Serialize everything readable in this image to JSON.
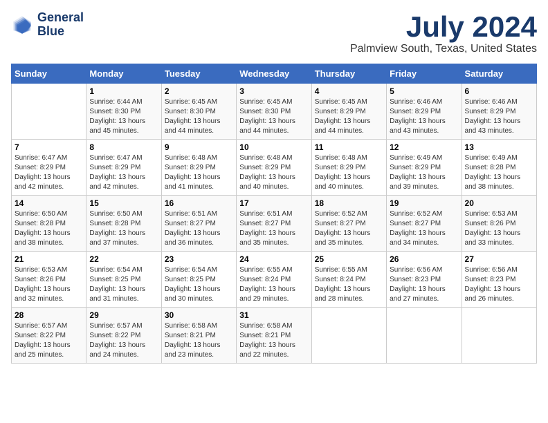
{
  "logo": {
    "line1": "General",
    "line2": "Blue"
  },
  "title": "July 2024",
  "subtitle": "Palmview South, Texas, United States",
  "days_of_week": [
    "Sunday",
    "Monday",
    "Tuesday",
    "Wednesday",
    "Thursday",
    "Friday",
    "Saturday"
  ],
  "weeks": [
    [
      {
        "num": "",
        "info": ""
      },
      {
        "num": "1",
        "info": "Sunrise: 6:44 AM\nSunset: 8:30 PM\nDaylight: 13 hours\nand 45 minutes."
      },
      {
        "num": "2",
        "info": "Sunrise: 6:45 AM\nSunset: 8:30 PM\nDaylight: 13 hours\nand 44 minutes."
      },
      {
        "num": "3",
        "info": "Sunrise: 6:45 AM\nSunset: 8:30 PM\nDaylight: 13 hours\nand 44 minutes."
      },
      {
        "num": "4",
        "info": "Sunrise: 6:45 AM\nSunset: 8:29 PM\nDaylight: 13 hours\nand 44 minutes."
      },
      {
        "num": "5",
        "info": "Sunrise: 6:46 AM\nSunset: 8:29 PM\nDaylight: 13 hours\nand 43 minutes."
      },
      {
        "num": "6",
        "info": "Sunrise: 6:46 AM\nSunset: 8:29 PM\nDaylight: 13 hours\nand 43 minutes."
      }
    ],
    [
      {
        "num": "7",
        "info": "Sunrise: 6:47 AM\nSunset: 8:29 PM\nDaylight: 13 hours\nand 42 minutes."
      },
      {
        "num": "8",
        "info": "Sunrise: 6:47 AM\nSunset: 8:29 PM\nDaylight: 13 hours\nand 42 minutes."
      },
      {
        "num": "9",
        "info": "Sunrise: 6:48 AM\nSunset: 8:29 PM\nDaylight: 13 hours\nand 41 minutes."
      },
      {
        "num": "10",
        "info": "Sunrise: 6:48 AM\nSunset: 8:29 PM\nDaylight: 13 hours\nand 40 minutes."
      },
      {
        "num": "11",
        "info": "Sunrise: 6:48 AM\nSunset: 8:29 PM\nDaylight: 13 hours\nand 40 minutes."
      },
      {
        "num": "12",
        "info": "Sunrise: 6:49 AM\nSunset: 8:29 PM\nDaylight: 13 hours\nand 39 minutes."
      },
      {
        "num": "13",
        "info": "Sunrise: 6:49 AM\nSunset: 8:28 PM\nDaylight: 13 hours\nand 38 minutes."
      }
    ],
    [
      {
        "num": "14",
        "info": "Sunrise: 6:50 AM\nSunset: 8:28 PM\nDaylight: 13 hours\nand 38 minutes."
      },
      {
        "num": "15",
        "info": "Sunrise: 6:50 AM\nSunset: 8:28 PM\nDaylight: 13 hours\nand 37 minutes."
      },
      {
        "num": "16",
        "info": "Sunrise: 6:51 AM\nSunset: 8:27 PM\nDaylight: 13 hours\nand 36 minutes."
      },
      {
        "num": "17",
        "info": "Sunrise: 6:51 AM\nSunset: 8:27 PM\nDaylight: 13 hours\nand 35 minutes."
      },
      {
        "num": "18",
        "info": "Sunrise: 6:52 AM\nSunset: 8:27 PM\nDaylight: 13 hours\nand 35 minutes."
      },
      {
        "num": "19",
        "info": "Sunrise: 6:52 AM\nSunset: 8:27 PM\nDaylight: 13 hours\nand 34 minutes."
      },
      {
        "num": "20",
        "info": "Sunrise: 6:53 AM\nSunset: 8:26 PM\nDaylight: 13 hours\nand 33 minutes."
      }
    ],
    [
      {
        "num": "21",
        "info": "Sunrise: 6:53 AM\nSunset: 8:26 PM\nDaylight: 13 hours\nand 32 minutes."
      },
      {
        "num": "22",
        "info": "Sunrise: 6:54 AM\nSunset: 8:25 PM\nDaylight: 13 hours\nand 31 minutes."
      },
      {
        "num": "23",
        "info": "Sunrise: 6:54 AM\nSunset: 8:25 PM\nDaylight: 13 hours\nand 30 minutes."
      },
      {
        "num": "24",
        "info": "Sunrise: 6:55 AM\nSunset: 8:24 PM\nDaylight: 13 hours\nand 29 minutes."
      },
      {
        "num": "25",
        "info": "Sunrise: 6:55 AM\nSunset: 8:24 PM\nDaylight: 13 hours\nand 28 minutes."
      },
      {
        "num": "26",
        "info": "Sunrise: 6:56 AM\nSunset: 8:23 PM\nDaylight: 13 hours\nand 27 minutes."
      },
      {
        "num": "27",
        "info": "Sunrise: 6:56 AM\nSunset: 8:23 PM\nDaylight: 13 hours\nand 26 minutes."
      }
    ],
    [
      {
        "num": "28",
        "info": "Sunrise: 6:57 AM\nSunset: 8:22 PM\nDaylight: 13 hours\nand 25 minutes."
      },
      {
        "num": "29",
        "info": "Sunrise: 6:57 AM\nSunset: 8:22 PM\nDaylight: 13 hours\nand 24 minutes."
      },
      {
        "num": "30",
        "info": "Sunrise: 6:58 AM\nSunset: 8:21 PM\nDaylight: 13 hours\nand 23 minutes."
      },
      {
        "num": "31",
        "info": "Sunrise: 6:58 AM\nSunset: 8:21 PM\nDaylight: 13 hours\nand 22 minutes."
      },
      {
        "num": "",
        "info": ""
      },
      {
        "num": "",
        "info": ""
      },
      {
        "num": "",
        "info": ""
      }
    ]
  ]
}
